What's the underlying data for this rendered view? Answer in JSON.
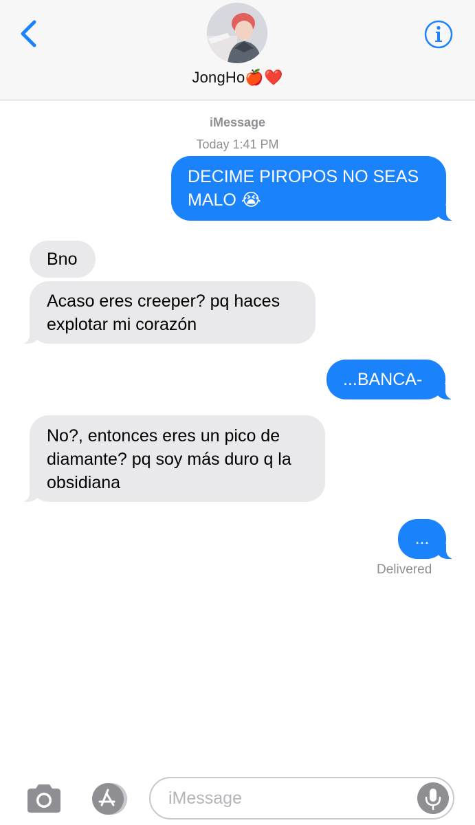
{
  "header": {
    "contact_name": "JongHo🍎❤️",
    "back_icon": "chevron-left-icon",
    "info_icon": "info-icon",
    "accent_color": "#1a82fb"
  },
  "thread": {
    "service": "iMessage",
    "timestamp": "Today 1:41 PM",
    "messages": [
      {
        "from": "me",
        "lines": [
          "DECIME PIROPOS NO SEAS",
          "MALO 😭"
        ]
      },
      {
        "from": "contact",
        "lines": [
          "Bno"
        ]
      },
      {
        "from": "contact",
        "lines": [
          "Acaso eres creeper? pq haces",
          "explotar mi corazón"
        ]
      },
      {
        "from": "me",
        "lines": [
          "...BANCA-"
        ]
      },
      {
        "from": "contact",
        "lines": [
          "No?, entonces eres un pico de",
          "diamante? pq soy más duro q la",
          "obsidiana"
        ]
      },
      {
        "from": "me",
        "lines": [
          "..."
        ]
      }
    ],
    "status": "Delivered"
  },
  "input_bar": {
    "camera_icon": "camera-icon",
    "apps_icon": "app-store-icon",
    "placeholder": "iMessage",
    "mic_icon": "microphone-icon"
  },
  "colors": {
    "sent_bubble": "#1a82fb",
    "received_bubble": "#e9e9eb",
    "meta_text": "#8e8e93"
  }
}
